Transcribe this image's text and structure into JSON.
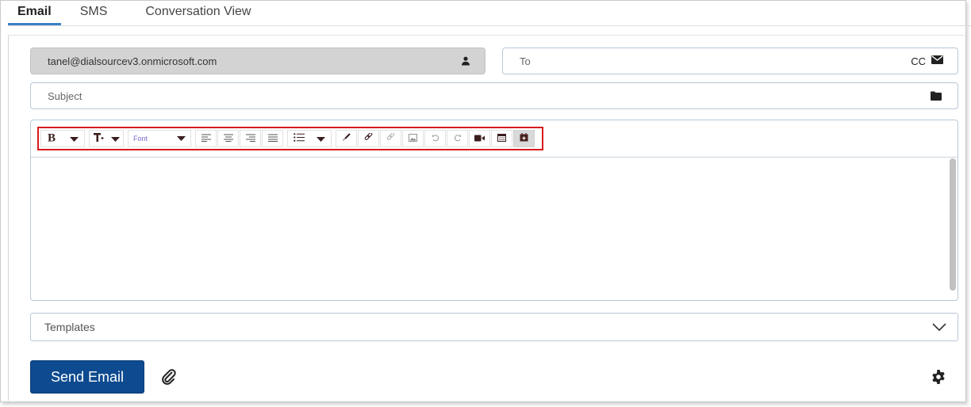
{
  "tabs": [
    {
      "label": "Email",
      "active": true
    },
    {
      "label": "SMS",
      "active": false
    },
    {
      "label": "Conversation View",
      "active": false
    }
  ],
  "from": {
    "value": "tanel@dialsourcev3.onmicrosoft.com",
    "icon": "person-icon"
  },
  "to": {
    "placeholder": "To",
    "cc_label": "CC",
    "icon": "envelope-icon"
  },
  "subject": {
    "placeholder": "Subject",
    "icon": "folder-icon"
  },
  "editor": {
    "font_select": "Font",
    "toolbar_icons": [
      "bold-icon",
      "text-size-icon",
      "align-left-icon",
      "align-center-icon",
      "align-right-icon",
      "justify-icon",
      "bullet-list-icon",
      "brush-icon",
      "link-icon",
      "unlink-icon",
      "image-icon",
      "undo-icon",
      "redo-icon",
      "video-icon",
      "calendar-icon",
      "calendar-event-icon"
    ],
    "highlight_color": "#d81b1b"
  },
  "templates": {
    "label": "Templates"
  },
  "footer": {
    "send_label": "Send Email",
    "send_color": "#0d4a8f"
  }
}
